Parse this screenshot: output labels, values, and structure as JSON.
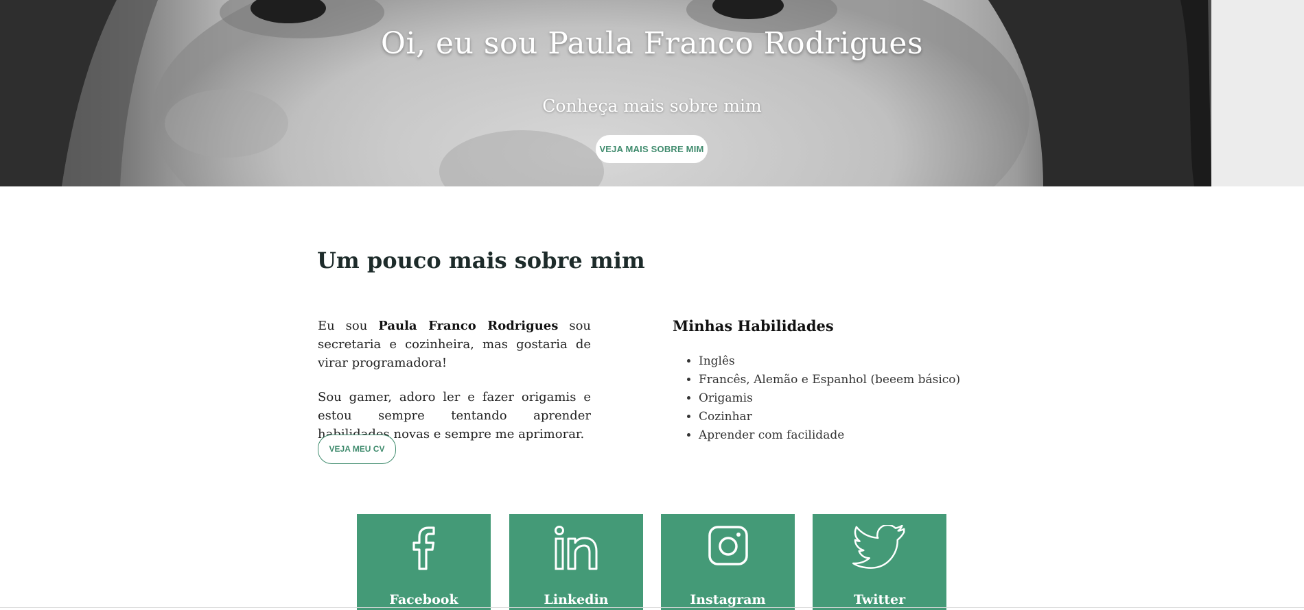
{
  "hero": {
    "title": "Oi, eu sou Paula Franco Rodrigues",
    "subtitle": "Conheça mais sobre mim",
    "button_label": "VEJA MAIS SOBRE MIM"
  },
  "about": {
    "heading": "Um pouco mais sobre mim",
    "intro_prefix": "Eu sou ",
    "intro_name": "Paula Franco Rodrigues",
    "intro_suffix": " sou secretaria e cozinheira, mas gostaria de virar programadora!",
    "paragraph2": "Sou gamer, adoro ler e fazer origamis e estou sempre tentando aprender habilidades novas e sempre me aprimorar.",
    "cv_button_label": "VEJA MEU CV"
  },
  "skills": {
    "heading": "Minhas Habilidades",
    "items": [
      "Inglês",
      "Francês, Alemão e Espanhol (beeem básico)",
      "Origamis",
      "Cozinhar",
      "Aprender com facilidade"
    ]
  },
  "social": {
    "cards": [
      {
        "label": "Facebook",
        "icon": "facebook-icon"
      },
      {
        "label": "Linkedin",
        "icon": "linkedin-icon"
      },
      {
        "label": "Instagram",
        "icon": "instagram-icon"
      },
      {
        "label": "Twitter",
        "icon": "twitter-icon"
      }
    ]
  },
  "colors": {
    "accent": "#449a77",
    "accent_text": "#3f8b6d",
    "heading": "#1d2b2a"
  }
}
